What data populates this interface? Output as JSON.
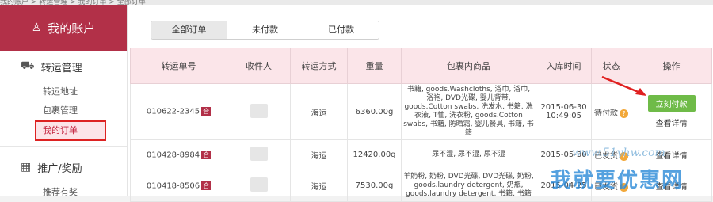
{
  "topbar": {
    "breadcrumb": "我的账户 > 转运管理 > 我的订单 > 全部订单"
  },
  "sidebar": {
    "account_title": "我的账户",
    "groups": [
      {
        "title": "转运管理",
        "items": [
          "转运地址",
          "包裹管理",
          "我的订单"
        ]
      },
      {
        "title": "推广/奖励",
        "items": [
          "推荐有奖"
        ]
      }
    ]
  },
  "tabs": [
    "全部订单",
    "未付款",
    "已付款"
  ],
  "table": {
    "headers": [
      "转运单号",
      "收件人",
      "转运方式",
      "重量",
      "包裹内商品",
      "入库时间",
      "状态",
      "操作"
    ],
    "rows": [
      {
        "order_no": "010622-2345",
        "badge": "合",
        "method": "海运",
        "weight": "6360.00g",
        "goods": "书籍, goods.Washcloths, 浴巾, 浴巾, 浴袍, DVD光碟, 婴儿背带, goods.Cotton swabs, 洗发水, 书籍, 洗衣液, T恤, 洗衣粉, goods.Cotton swabs, 书籍, 防晒霜, 婴儿餐具, 书籍, 书籍",
        "date": "2015-06-30",
        "time": "10:49:05",
        "status": "待付款",
        "pay_label": "立刻付款",
        "detail_label": "查看详情"
      },
      {
        "order_no": "010428-8984",
        "badge": "合",
        "method": "海运",
        "weight": "12420.00g",
        "goods": "尿不湿, 尿不湿, 尿不湿",
        "date": "2015-05-30",
        "time": "",
        "status": "已发货",
        "detail_label": "查看详情"
      },
      {
        "order_no": "010418-8506",
        "badge": "合",
        "method": "海运",
        "weight": "7530.00g",
        "goods": "羊奶粉, 奶粉, DVD光碟, DVD光碟, 奶粉, goods.laundry detergent, 奶瓶, goods.laundry detergent, 书籍, 书籍",
        "date": "2015-04-25",
        "time": "",
        "status": "已发货",
        "detail_label": "查看详情"
      }
    ]
  },
  "watermark": {
    "url": "www.51yhw.com",
    "text": "我就要优惠网"
  },
  "colors": {
    "accent": "#b23048",
    "pay_button": "#6fbb48",
    "header_bg": "#fbe5e9",
    "highlight_border": "#dd2222",
    "arrow": "#e02020"
  }
}
